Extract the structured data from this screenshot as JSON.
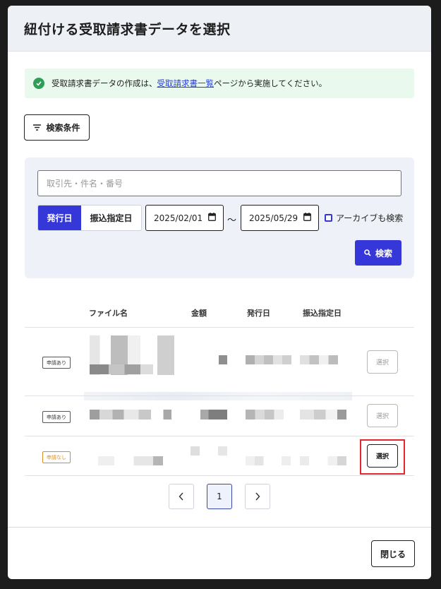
{
  "modal": {
    "title": "紐付ける受取請求書データを選択",
    "alert": {
      "prefix": "受取請求書データの作成は、",
      "link": "受取請求書一覧",
      "suffix": "ページから実施してください。"
    },
    "filter_button": "検索条件",
    "search": {
      "keyword_placeholder": "取引先・件名・番号",
      "date_type_options": [
        "発行日",
        "振込指定日"
      ],
      "date_type_selected": "発行日",
      "date_from": "2025/02/01",
      "date_to": "2025/05/29",
      "range_sep": "〜",
      "archive_label": "アーカイブも検索",
      "search_button": "検索"
    },
    "table": {
      "columns": [
        "ファイル名",
        "金額",
        "発行日",
        "振込指定日"
      ],
      "rows": [
        {
          "badge": "申請あり",
          "action": "選択",
          "enabled": false
        },
        {
          "badge": "申請あり",
          "action": "選択",
          "enabled": false
        },
        {
          "badge": "申請なし",
          "action": "選択",
          "enabled": true
        }
      ]
    },
    "pagination": {
      "prev": "‹",
      "current": "1",
      "next": "›"
    },
    "close_button": "閉じる"
  },
  "colors": {
    "primary": "#3537d8",
    "success": "#2e9e57",
    "highlight": "#e3262f",
    "warning": "#d98c1f"
  },
  "icons": [
    "check-circle-icon",
    "filter-icon",
    "calendar-icon",
    "search-icon",
    "chevron-left-icon",
    "chevron-right-icon"
  ]
}
